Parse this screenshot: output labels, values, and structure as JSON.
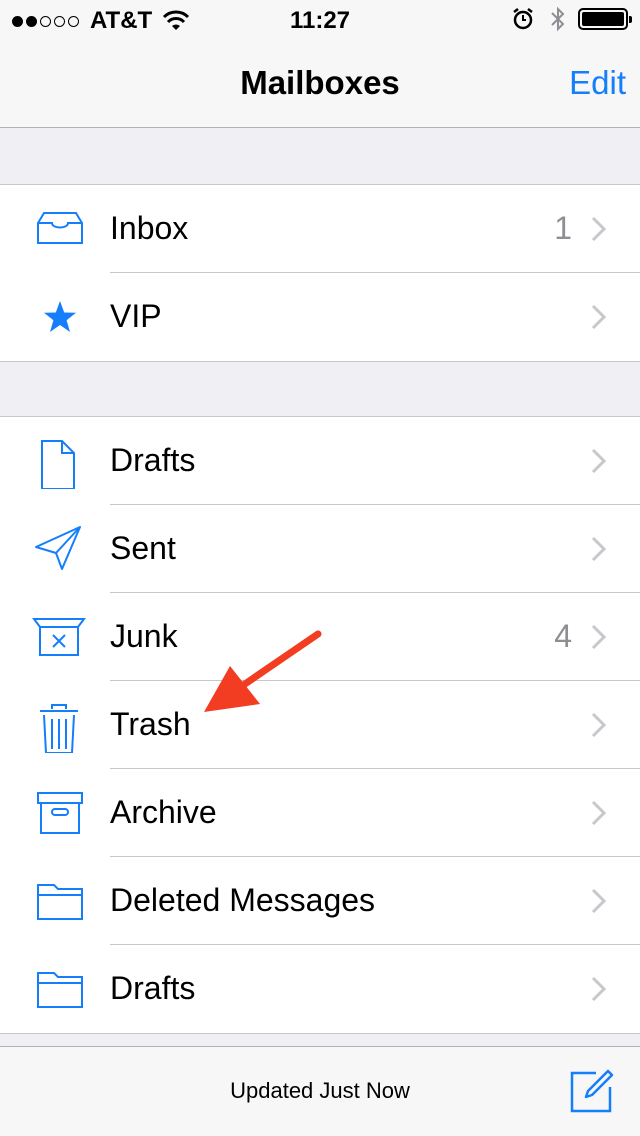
{
  "status_bar": {
    "carrier": "AT&T",
    "time": "11:27",
    "signal_bars_filled": 2,
    "signal_bars_total": 5
  },
  "nav": {
    "title": "Mailboxes",
    "edit_label": "Edit"
  },
  "sections": [
    {
      "items": [
        {
          "label": "Inbox",
          "count": "1",
          "icon": "inbox-icon"
        },
        {
          "label": "VIP",
          "count": "",
          "icon": "star-icon"
        }
      ]
    },
    {
      "items": [
        {
          "label": "Drafts",
          "count": "",
          "icon": "document-icon"
        },
        {
          "label": "Sent",
          "count": "",
          "icon": "paper-plane-icon"
        },
        {
          "label": "Junk",
          "count": "4",
          "icon": "junk-bin-icon"
        },
        {
          "label": "Trash",
          "count": "",
          "icon": "trash-icon"
        },
        {
          "label": "Archive",
          "count": "",
          "icon": "archive-box-icon"
        },
        {
          "label": "Deleted Messages",
          "count": "",
          "icon": "folder-icon"
        },
        {
          "label": "Drafts",
          "count": "",
          "icon": "folder-icon"
        }
      ]
    }
  ],
  "toolbar": {
    "status_text": "Updated Just Now"
  },
  "colors": {
    "accent": "#157efb",
    "annotation_arrow": "#f23d22",
    "count_gray": "#8e8e93",
    "chevron_gray": "#c7c7cc",
    "background": "#efeff4"
  }
}
